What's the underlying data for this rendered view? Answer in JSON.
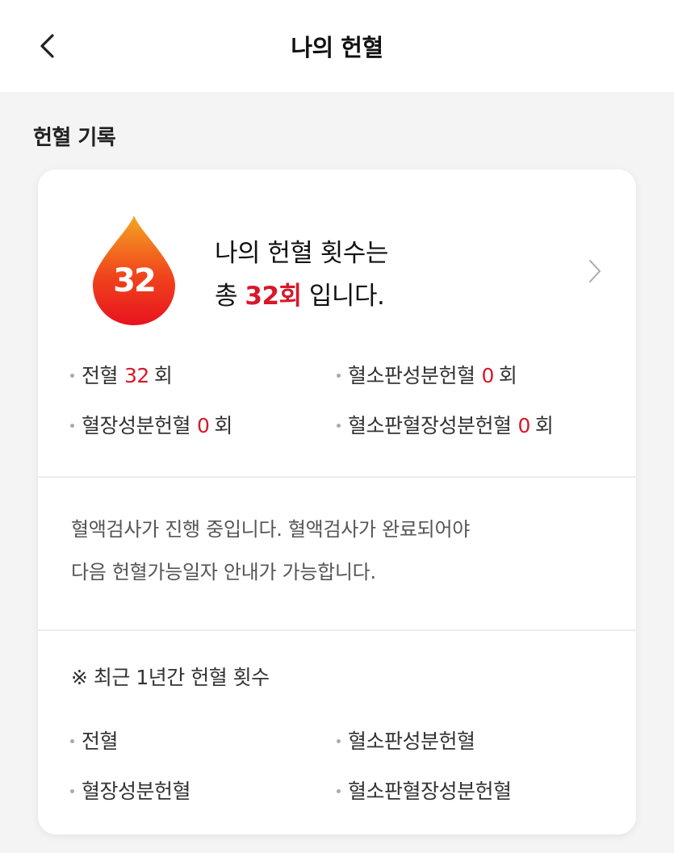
{
  "header": {
    "title": "나의 헌혈"
  },
  "section": {
    "title": "헌혈 기록"
  },
  "summary": {
    "count_badge": "32",
    "line1": "나의 헌혈 횟수는",
    "line2_prefix": "총 ",
    "line2_highlight": "32회",
    "line2_suffix": " 입니다."
  },
  "stats": [
    {
      "label": "전혈",
      "value": "32",
      "unit": "회"
    },
    {
      "label": "혈소판성분헌혈",
      "value": "0",
      "unit": "회"
    },
    {
      "label": "혈장성분헌혈",
      "value": "0",
      "unit": "회"
    },
    {
      "label": "혈소판혈장성분헌혈",
      "value": "0",
      "unit": "회"
    }
  ],
  "notice": {
    "line1": "혈액검사가 진행 중입니다. 혈액검사가 완료되어야",
    "line2": "다음 헌혈가능일자 안내가 가능합니다."
  },
  "recent": {
    "title": "※ 최근 1년간 헌혈 횟수",
    "items": [
      "전혈",
      "혈소판성분헌혈",
      "혈장성분헌혈",
      "혈소판혈장성분헌혈"
    ]
  },
  "colors": {
    "accent": "#d7182a",
    "drop_top": "#f5a623",
    "drop_bottom": "#e8131e"
  },
  "icons": {
    "back": "chevron-left-icon",
    "detail": "chevron-right-icon",
    "badge": "blood-drop-icon"
  }
}
